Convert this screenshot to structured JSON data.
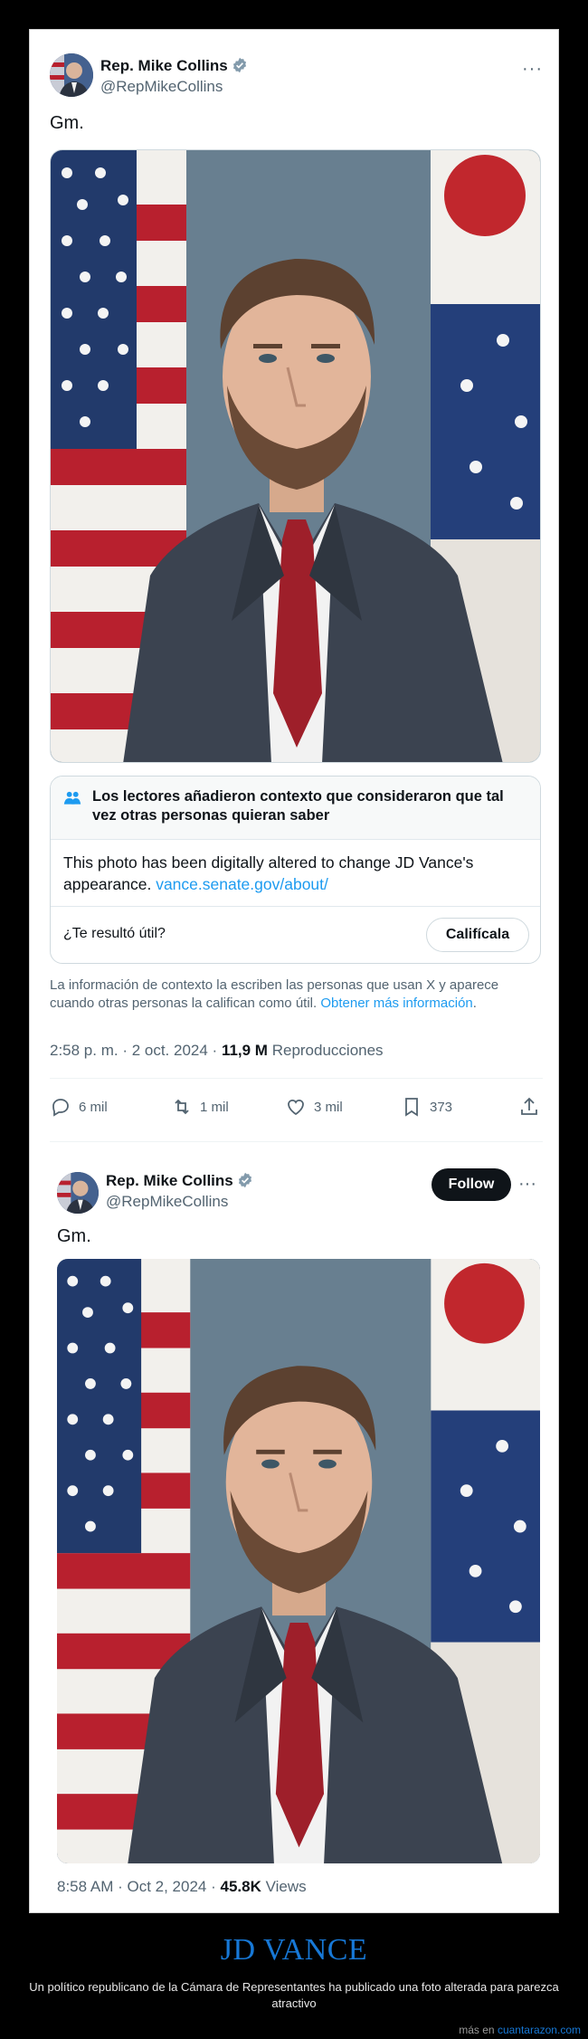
{
  "tweet1": {
    "author_name": "Rep. Mike Collins",
    "handle": "@RepMikeCollins",
    "more_label": "···",
    "text": "Gm.",
    "photo_alt": "Portrait photo",
    "community_note": {
      "title": "Los lectores añadieron contexto que consideraron que tal vez otras personas quieran saber",
      "body": "This photo has been digitally altered to change JD Vance's appearance.",
      "link": "vance.senate.gov/about/",
      "question": "¿Te resultó útil?",
      "rate_button": "Califícala"
    },
    "context_info": "La información de contexto la escriben las personas que usan X y aparece cuando otras personas la califican como útil.",
    "context_link": "Obtener más información",
    "context_period": ".",
    "timestamp": "2:58 p. m. · 2 oct. 2024 · ",
    "views_count": "11,9 M",
    "views_label": " Reproducciones",
    "actions": {
      "replies": "6 mil",
      "reposts": "1 mil",
      "likes": "3 mil",
      "bookmarks": "373"
    }
  },
  "tweet2": {
    "author_name": "Rep. Mike Collins",
    "handle": "@RepMikeCollins",
    "follow_label": "Follow",
    "more_label": "···",
    "text": "Gm.",
    "timestamp": "8:58 AM · Oct 2, 2024 · ",
    "views_count": "45.8K",
    "views_label": " Views"
  },
  "footer": {
    "headline": "JD VANCE",
    "caption": "Un político republicano de la Cámara de Representantes ha publicado una foto alterada para parezca atractivo",
    "more_prefix": "más en ",
    "site": "cuantarazon.com"
  },
  "colors": {
    "x_blue": "#1d9bf0",
    "text_primary": "#0f1419",
    "text_secondary": "#536471",
    "headline_blue": "#1778d6"
  }
}
